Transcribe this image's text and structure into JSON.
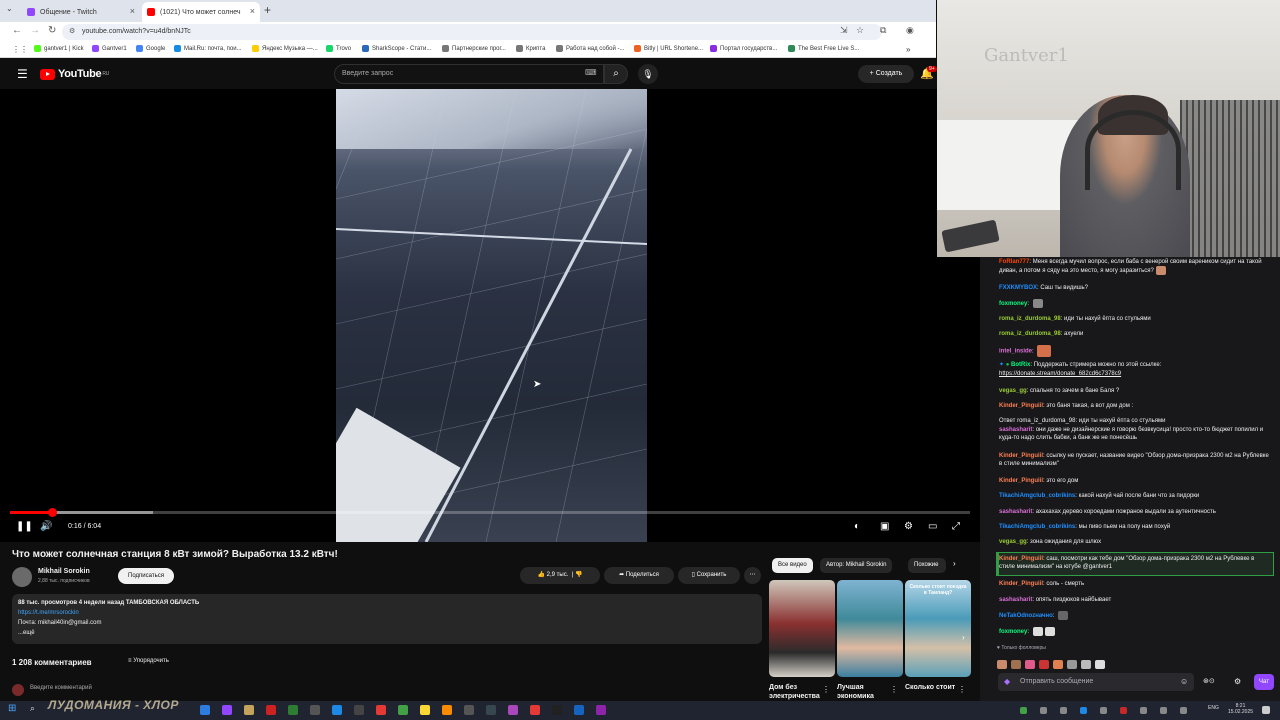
{
  "browser": {
    "tabs": [
      {
        "title": "Общение - Twitch",
        "color": "#9147ff"
      },
      {
        "title": "(1021) Что может солнеч",
        "color": "#ff0000"
      }
    ],
    "new_tab": "+",
    "url": "youtube.com/watch?v=u4d/bnNJTc",
    "bookmarks": [
      {
        "label": "gantver1 | Kick",
        "color": "#53fc18"
      },
      {
        "label": "Gantver1",
        "color": "#9147ff"
      },
      {
        "label": "Google",
        "color": "#4285f4"
      },
      {
        "label": "Mail.Ru: почта, пои...",
        "color": "#168de2"
      },
      {
        "label": "Яндекс Музыка —...",
        "color": "#ffcc00"
      },
      {
        "label": "Trovo",
        "color": "#19d66b"
      },
      {
        "label": "SharkScope - Стати...",
        "color": "#2a6ab8"
      },
      {
        "label": "Партнерские прог...",
        "color": "#777777"
      },
      {
        "label": "Крипта",
        "color": "#777777"
      },
      {
        "label": "Работа над собой -...",
        "color": "#777777"
      },
      {
        "label": "Bitly | URL Shortene...",
        "color": "#ee6123"
      },
      {
        "label": "Портал государств...",
        "color": "#8a2be2"
      },
      {
        "label": "The Best Free Live S...",
        "color": "#2e8b57"
      }
    ]
  },
  "youtube": {
    "logo_text": "YouTube",
    "logo_region": "RU",
    "search_placeholder": "Введите запрос",
    "create_label": "Создать",
    "bell_badge": "9+",
    "video": {
      "time_current": "0:16",
      "time_total": "6:04",
      "time_separator": " / ",
      "progress": 0.044,
      "title": "Что может солнечная станция 8 кВт зимой? Выработка 13.2 кВтч!",
      "channel": "Mikhail Sorokin",
      "subscribers": "2,88 тыс. подписчиков",
      "subscribe_label": "Подписаться",
      "likes": "2,9 тыс.",
      "share_label": "Поделиться",
      "save_label": "Сохранить",
      "desc_meta": "88 тыс. просмотров  4 недели назад  ТАМБОВСКАЯ ОБЛАСТЬ",
      "desc_link": "https://t.me/mrsorockin",
      "desc_mail": "Почта: mikhail40in@gmail.com",
      "desc_more": "...ещё"
    },
    "comments": {
      "count": "1 208 комментариев",
      "sort_label": "Упорядочить",
      "input_placeholder": "Введите комментарий"
    },
    "related": {
      "chips": [
        "Все видео",
        "Автор: Mikhail Sorokin",
        "Похожие"
      ],
      "thumb3_text": "Сколько стоит поездка в Таиланд?",
      "titles": [
        "Дом без электричества",
        "Лучшая экономика",
        "Сколько стоит"
      ]
    }
  },
  "stream": {
    "watermark": "Gantver1"
  },
  "chat": {
    "messages": [
      {
        "user": "FoRlan777",
        "color": "#ff4500",
        "text": "Меня всегда мучил вопрос, если баба с венерой своим вареником сидит на такой диван, а потом я сяду на это место, я могу заразиться?"
      },
      {
        "user": "FXXKMYBOX",
        "color": "#1e90ff",
        "text": "Саш ты видишь?"
      },
      {
        "user": "foxmoney",
        "color": "#00ff7f",
        "text": ""
      },
      {
        "user": "roma_iz_durdoma_98",
        "color": "#9acd32",
        "text": "иди ты нахуй ёпта со стульями"
      },
      {
        "user": "roma_iz_durdoma_98",
        "color": "#9acd32",
        "text": "ахуели"
      },
      {
        "user": "intel_inside",
        "color": "#da70d6",
        "text": ""
      },
      {
        "user": "BotRix",
        "color": "#00ff7f",
        "text": "Поддержать стримера можно по этой ссылке:"
      },
      {
        "user": "",
        "color": "#efeff1",
        "text": "https://donate.stream/donate_682cd6c7378c9"
      },
      {
        "user": "vegas_gg",
        "color": "#9acd32",
        "text": "спальня то зачем в бане Баля ?"
      },
      {
        "user": "Kinder_Pinguiil",
        "color": "#ff7f50",
        "text": "это баня такая, а вот дом дом :"
      },
      {
        "user": "",
        "color": "#adadb8",
        "text": "Ответ roma_iz_durdoma_98: иди ты нахуй ёпта со стульями"
      },
      {
        "user": "sashasharit",
        "color": "#da70d6",
        "text": "они даже не дизайнерские  я говорю безвкусица! просто кто-то бюджет попилил и куда-то надо слить бабки, а банк же не понесёшь"
      },
      {
        "user": "Kinder_Pinguiil",
        "color": "#ff7f50",
        "text": "ссылку не пускает, название видео \"Обзор дома-призрака 2300 м2 на Рублевке в стиле минимализм\""
      },
      {
        "user": "Kinder_Pinguiil",
        "color": "#ff7f50",
        "text": "это его дом"
      },
      {
        "user": "TikachiAmgclub_cobrikins",
        "color": "#1e90ff",
        "text": "какой нахуй чай после бани что за пидорки"
      },
      {
        "user": "sashasharit",
        "color": "#da70d6",
        "text": "ахахахах дерево короедами пожраное выдали за аутентичность"
      },
      {
        "user": "TikachiAmgclub_cobrikins",
        "color": "#1e90ff",
        "text": "мы пиво пьем на полу нам похуй"
      },
      {
        "user": "vegas_gg",
        "color": "#9acd32",
        "text": "зона ожидания для шлюх"
      },
      {
        "user": "Kinder_Pinguiil",
        "color": "#ff7f50",
        "text": "саш, посмотри как тебе дом \"Обзор дома-призрака 2300 м2 на Рублевке в стиле минимализм\" на ютубе @gantver1"
      },
      {
        "user": "Kinder_Pinguiil",
        "color": "#ff7f50",
        "text": "соль - смерть"
      },
      {
        "user": "sashasharit",
        "color": "#da70d6",
        "text": "опять пиздюков найбывает"
      },
      {
        "user": "NeTakOdnozначно",
        "color": "#1e90ff",
        "text": ""
      },
      {
        "user": "foxmoney",
        "color": "#00ff7f",
        "text": ""
      }
    ],
    "followers_only": "Только фолловеры",
    "input_placeholder": "Отправить сообщение",
    "send_label": "Чат"
  },
  "taskbar": {
    "overlay_text": "ЛУДОМАНИЯ - ХЛОР",
    "lang": "ENG",
    "time": "8:21",
    "date": "15.02.2025"
  }
}
